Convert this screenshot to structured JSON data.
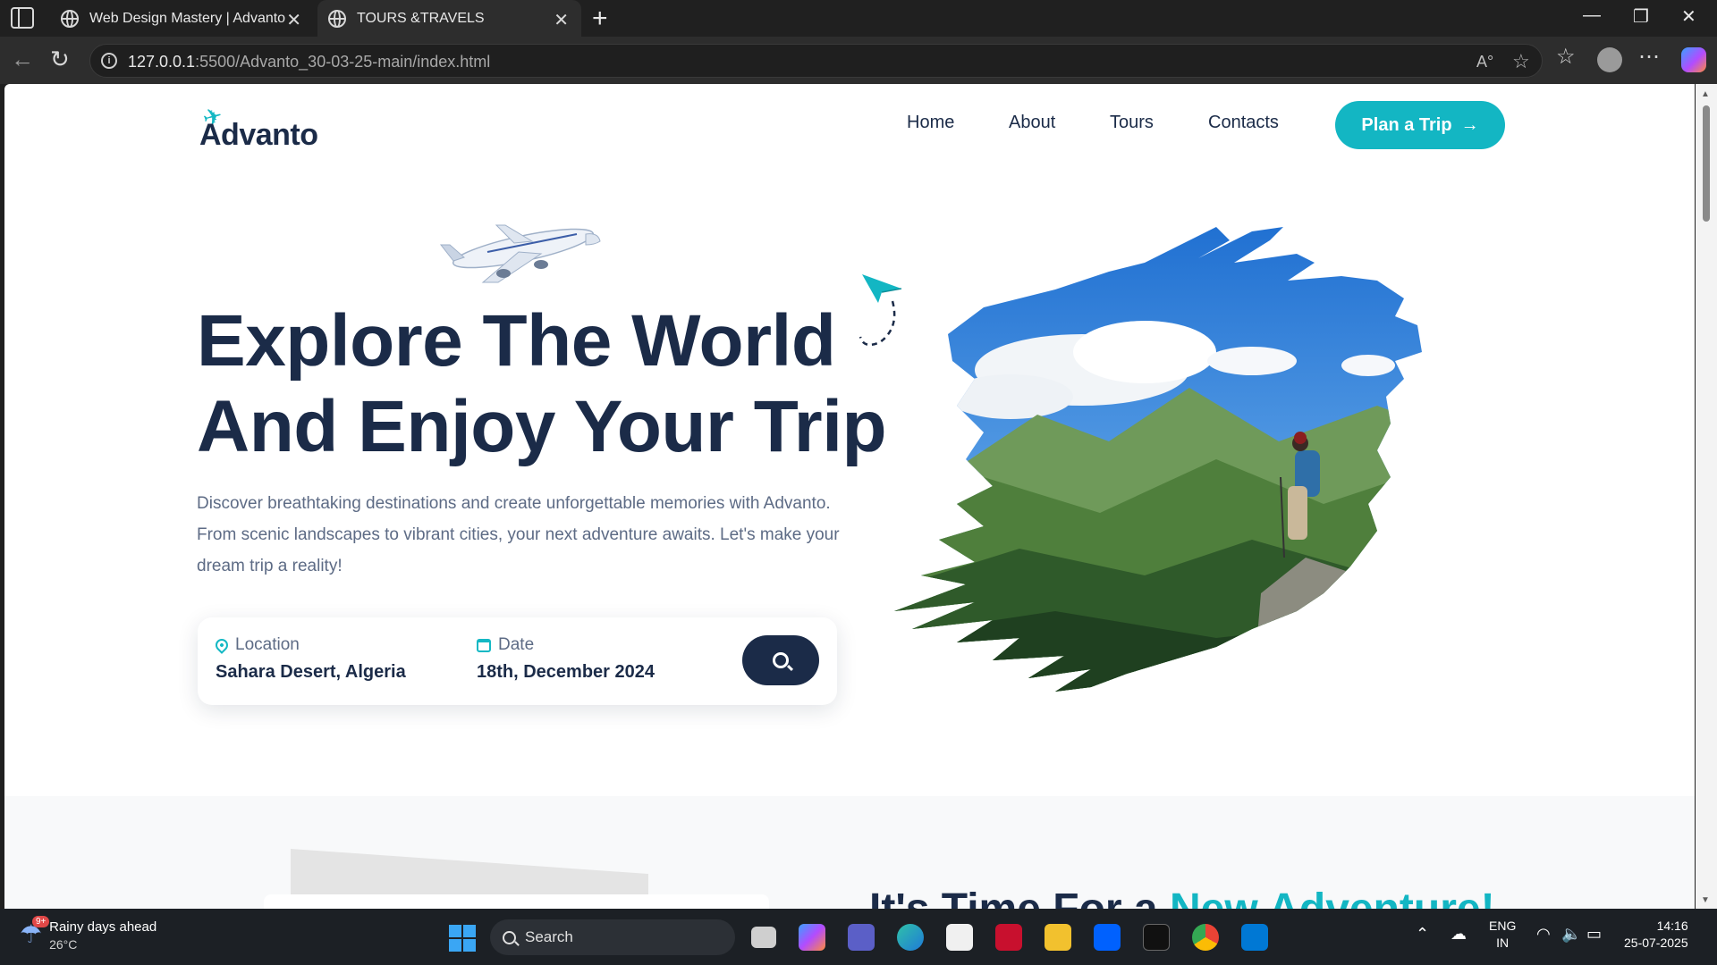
{
  "browser": {
    "tabs": [
      {
        "title": "Web Design Mastery | Advanto",
        "active": false
      },
      {
        "title": "TOURS &TRAVELS",
        "active": true
      }
    ],
    "url_host": "127.0.0.1",
    "url_rest": ":5500/Advanto_30-03-25-main/index.html"
  },
  "site": {
    "logo": "Advanto",
    "nav": [
      "Home",
      "About",
      "Tours",
      "Contacts"
    ],
    "cta": "Plan a Trip"
  },
  "hero": {
    "title_line1": "Explore The World",
    "title_line2": "And Enjoy Your Trip",
    "description": "Discover breathtaking destinations and create unforgettable memories with Advanto. From scenic landscapes to vibrant cities, your next adventure awaits. Let's make your dream trip a reality!",
    "search": {
      "location_label": "Location",
      "location_value": "Sahara Desert, Algeria",
      "date_label": "Date",
      "date_value": "18th, December 2024"
    }
  },
  "section2": {
    "title_main": "It's Time For a ",
    "title_accent": "New Adventure!"
  },
  "taskbar": {
    "weather_title": "Rainy days ahead",
    "weather_temp": "26°C",
    "weather_badge": "9+",
    "search_placeholder": "Search",
    "lang_line1": "ENG",
    "lang_line2": "IN",
    "time": "14:16",
    "date": "25-07-2025"
  },
  "colors": {
    "accent": "#13b6c3",
    "navy": "#1b2b48",
    "body_text": "#5d6b85"
  }
}
